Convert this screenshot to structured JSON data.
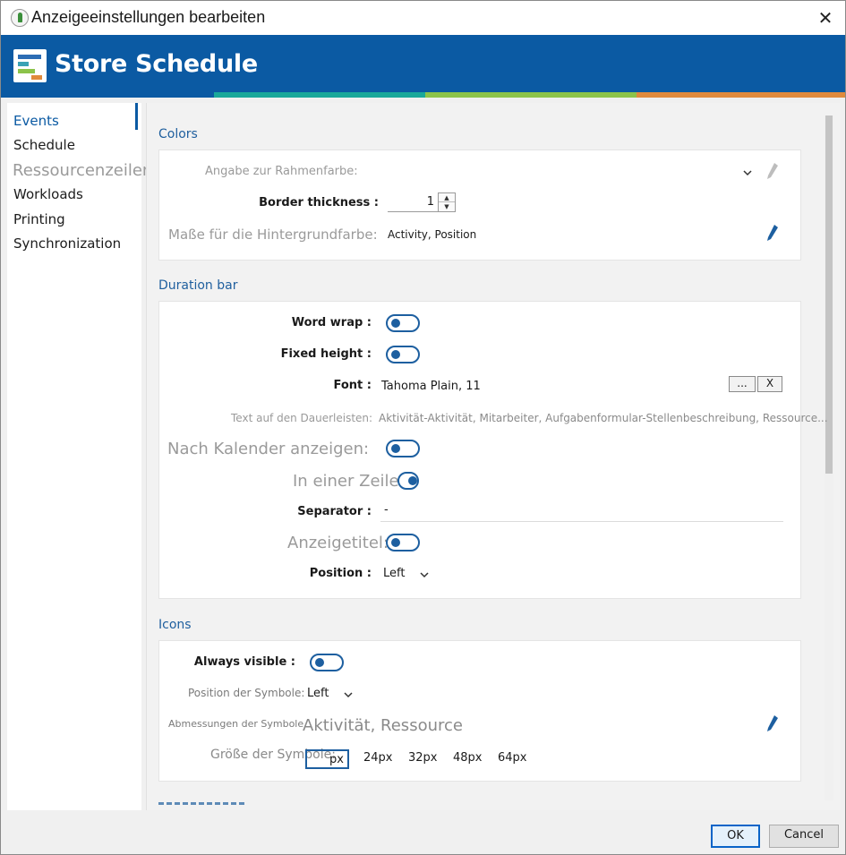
{
  "window": {
    "title": "Anzeigeeinstellungen bearbeiten",
    "close_glyph": "✕"
  },
  "banner": {
    "title": "Store Schedule",
    "stripe_colors": [
      "#1aa89a",
      "#8cc34a",
      "#e08a3c"
    ]
  },
  "sidebar": {
    "items": [
      "Events",
      "Schedule",
      "Workloads",
      "Printing",
      "Synchronization"
    ],
    "active": "Events",
    "overlay_label": "Ressourcenzeilen"
  },
  "colors_section": {
    "title": "Colors",
    "border_color_label": "Angabe zur Rahmenfarbe:",
    "border_thickness_label": "Border thickness :",
    "border_thickness_value": "1",
    "background_label": "Maße für die Hintergrundfarbe:",
    "background_value": "Activity, Position"
  },
  "duration_section": {
    "title": "Duration bar",
    "word_wrap_label": "Word wrap :",
    "fixed_height_label": "Fixed height :",
    "font_label": "Font :",
    "font_value": "Tahoma Plain, 11",
    "font_browse_label": "...",
    "font_clear_label": "X",
    "bar_text_label": "Text auf den Dauerleisten:",
    "bar_text_value": "Aktivität-Aktivität, Mitarbeiter, Aufgabenformular-Stellenbeschreibung, Ressource...",
    "show_by_calendar_label": "Nach Kalender anzeigen:",
    "single_line_label": "In einer Zeile:",
    "separator_label": "Separator :",
    "separator_value": "-",
    "display_title_label": "Anzeigetitel:",
    "position_label": "Position :",
    "position_value": "Left"
  },
  "icons_section": {
    "title": "Icons",
    "always_visible_label": "Always visible :",
    "icon_position_label": "Position der Symbole:",
    "icon_position_value": "Left",
    "icon_dimensions_label": "Abmessungen der Symbole",
    "icon_dimensions_value": "Aktivität, Ressource",
    "icon_size_label": "Größe der Symbole:",
    "sizes": [
      "px",
      "24px",
      "32px",
      "48px",
      "64px"
    ]
  },
  "footer": {
    "ok_label": "OK",
    "cancel_label": "Cancel"
  },
  "theme": {
    "accent": "#0b5aa3",
    "section_title": "#1f5f9e",
    "toggle": "#1d5fa0"
  }
}
